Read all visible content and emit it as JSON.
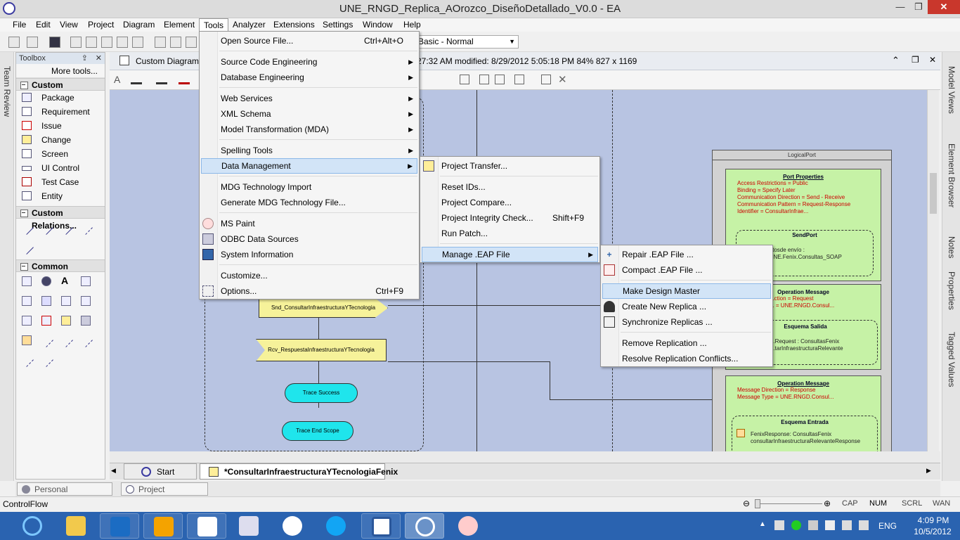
{
  "window": {
    "title": "UNE_RNGD_Replica_AOrozco_DiseñoDetallado_V0.0 - EA"
  },
  "menubar": [
    "File",
    "Edit",
    "View",
    "Project",
    "Diagram",
    "Element",
    "Tools",
    "Analyzer",
    "Extensions",
    "Settings",
    "Window",
    "Help"
  ],
  "toolbar": {
    "perspective": "Basic - Normal"
  },
  "left_tab": "Team Review",
  "toolbox": {
    "title": "Toolbox",
    "more": "More tools...",
    "custom": {
      "header": "Custom",
      "items": [
        "Package",
        "Requirement",
        "Issue",
        "Change",
        "Screen",
        "UI Control",
        "Test Case",
        "Entity"
      ]
    },
    "custom_rel": {
      "header": "Custom Relations..."
    },
    "common": {
      "header": "Common"
    }
  },
  "diagram": {
    "title": "Custom Diagram: \"",
    "info": "27:32 AM  modified: 8/29/2012 5:05:18 PM   84%   827 x 1169"
  },
  "canvas": {
    "snd": "Snd_ConsultarInfraestructuraYTecnologia",
    "rcv": "Rcv_RespuestaInfraestructuraYTecnologia",
    "trace_success": "Trace Success",
    "trace_end": "Trace End Scope",
    "logical_port": "LogicalPort",
    "port_props": {
      "title": "Port Properties",
      "lines": [
        "Access Restrictions = Public",
        "Binding = Specify Later",
        "Communication Direction = Send - Receive",
        "Communication Pattern = Request-Response",
        "Identifier = ConsultarInfrae..."
      ]
    },
    "sendport": {
      "title": "SendPort",
      "lines": [
        "...otosde envío :",
        "...UNE.Fenix.Consultas_SOAP"
      ]
    },
    "op1": {
      "title": "Operation Message",
      "lines": [
        "...ction = Request",
        "... = UNE.RNGD.Consul..."
      ],
      "schema": "Esquema Salida",
      "schema_lines": [
        "...Request : ConsultasFenix",
        "...tarInfraestructuraRelevante"
      ]
    },
    "op2": {
      "title": "Operation Message",
      "lines": [
        "Message Direction = Response",
        "Message Type = UNE.RNGD.Consul..."
      ],
      "schema": "Esquema Entrada",
      "schema_lines": [
        "FenixResponse: ConsultasFenix",
        "consultarInfraestructuraRelevanteResponse"
      ]
    }
  },
  "tools_menu": [
    {
      "label": "Open Source File...",
      "shortcut": "Ctrl+Alt+O"
    },
    {
      "label": "Source Code Engineering",
      "sub": true
    },
    {
      "label": "Database Engineering",
      "sub": true
    },
    {
      "label": "Web Services",
      "sub": true
    },
    {
      "label": "XML Schema",
      "sub": true
    },
    {
      "label": "Model Transformation (MDA)",
      "sub": true
    },
    {
      "label": "Spelling Tools",
      "sub": true
    },
    {
      "label": "Data Management",
      "sub": true
    },
    {
      "label": "MDG Technology Import"
    },
    {
      "label": "Generate MDG Technology File..."
    },
    {
      "label": "MS Paint"
    },
    {
      "label": "ODBC Data Sources"
    },
    {
      "label": "System Information"
    },
    {
      "label": "Customize..."
    },
    {
      "label": "Options...",
      "shortcut": "Ctrl+F9"
    }
  ],
  "data_menu": [
    {
      "label": "Project Transfer..."
    },
    {
      "label": "Reset IDs..."
    },
    {
      "label": "Project Compare..."
    },
    {
      "label": "Project Integrity Check...",
      "shortcut": "Shift+F9"
    },
    {
      "label": "Run Patch..."
    },
    {
      "label": "Manage .EAP File",
      "sub": true
    }
  ],
  "eap_menu": [
    {
      "label": "Repair .EAP File ..."
    },
    {
      "label": "Compact .EAP File ..."
    },
    {
      "label": "Make Design Master"
    },
    {
      "label": "Create New Replica ..."
    },
    {
      "label": "Synchronize Replicas ..."
    },
    {
      "label": "Remove Replication ..."
    },
    {
      "label": "Resolve Replication Conflicts..."
    }
  ],
  "tabs": {
    "start": "Start Page",
    "current": "*ConsultarInfraestructuraYTecnologiaFenix"
  },
  "right_tabs": [
    "Model Views",
    "Element Browser",
    "Notes",
    "Properties",
    "Tagged Values"
  ],
  "bottom_tabs": [
    "Personal Information",
    "Project Information"
  ],
  "status": {
    "left": "ControlFlow",
    "cap": "CAP",
    "num": "NUM",
    "scrl": "SCRL",
    "wan": "WAN"
  },
  "taskbar": {
    "lang": "ENG",
    "time": "4:09 PM",
    "date": "10/5/2012"
  }
}
